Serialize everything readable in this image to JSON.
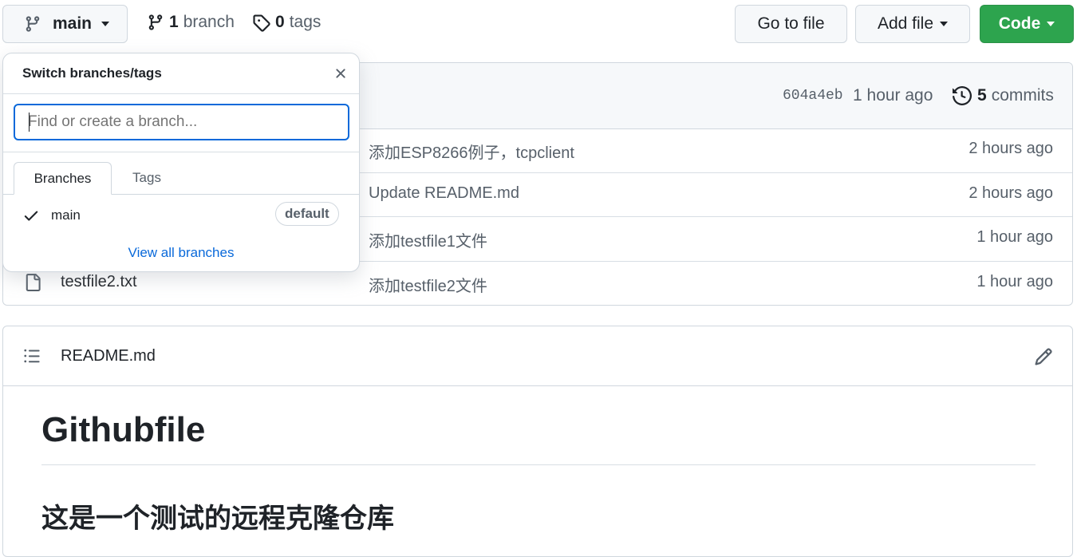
{
  "branch_bar": {
    "current_branch": "main",
    "branch_count": "1",
    "branch_word": "branch",
    "tag_count": "0",
    "tag_word": "tags"
  },
  "actions": {
    "go_to_file": "Go to file",
    "add_file": "Add file",
    "code": "Code"
  },
  "commit_header": {
    "sha": "604a4eb",
    "time": "1 hour ago",
    "commit_count": "5",
    "commit_word": "commits"
  },
  "files": [
    {
      "name": "",
      "message": "添加ESP8266例子，tcpclient",
      "time": "2 hours ago"
    },
    {
      "name": "",
      "message": "Update README.md",
      "time": "2 hours ago"
    },
    {
      "name": "",
      "message": "添加testfile1文件",
      "time": "1 hour ago"
    },
    {
      "name": "testfile2.txt",
      "message": "添加testfile2文件",
      "time": "1 hour ago"
    }
  ],
  "dropdown": {
    "title": "Switch branches/tags",
    "search_placeholder": "Find or create a branch...",
    "tabs": [
      "Branches",
      "Tags"
    ],
    "branch_item": "main",
    "default_badge": "default",
    "view_all": "View all branches"
  },
  "readme": {
    "filename": "README.md",
    "h1": "Githubfile",
    "h2": "这是一个测试的远程克隆仓库"
  },
  "colors": {
    "accent_green": "#2da44e",
    "link_blue": "#0969da",
    "focus_blue": "#0969da"
  }
}
